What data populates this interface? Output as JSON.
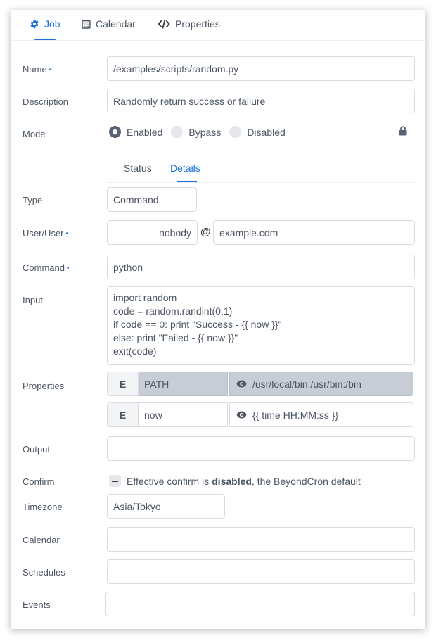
{
  "tabs": [
    {
      "label": "Job",
      "icon": "gear-icon",
      "active": true
    },
    {
      "label": "Calendar",
      "icon": "calendar-icon",
      "active": false
    },
    {
      "label": "Properties",
      "icon": "code-icon",
      "active": false
    }
  ],
  "fields": {
    "name": {
      "label": "Name",
      "required_marker": "•",
      "value": "/examples/scripts/random.py"
    },
    "description": {
      "label": "Description",
      "value": "Randomly return success or failure"
    },
    "mode": {
      "label": "Mode",
      "options": [
        "Enabled",
        "Bypass",
        "Disabled"
      ],
      "selected": "Enabled",
      "lock_icon": "lock-icon"
    },
    "subtabs": [
      {
        "label": "Status",
        "active": false
      },
      {
        "label": "Details",
        "active": true
      }
    ],
    "type": {
      "label": "Type",
      "value": "Command"
    },
    "user": {
      "label": "User/User",
      "required_marker": "•",
      "user_value": "nobody",
      "at_symbol": "@",
      "host_value": "example.com"
    },
    "command": {
      "label": "Command",
      "required_marker": "•",
      "value": "python"
    },
    "input": {
      "label": "Input",
      "value": "import random\ncode = random.randint(0,1)\nif code == 0: print \"Success - {{ now }}\"\nelse: print \"Failed - {{ now }}\"\nexit(code)"
    },
    "properties": {
      "label": "Properties",
      "rows": [
        {
          "type": "E",
          "key": "PATH",
          "value": "/usr/local/bin:/usr/bin:/bin",
          "readonly": true
        },
        {
          "type": "E",
          "key": "now",
          "value": "{{ time HH:MM:ss }}",
          "readonly": false
        }
      ]
    },
    "output": {
      "label": "Output",
      "value": ""
    },
    "confirm": {
      "label": "Confirm",
      "text_before": "Effective confirm is ",
      "text_bold": "disabled",
      "text_after": ", the BeyondCron default"
    },
    "timezone": {
      "label": "Timezone",
      "value": "Asia/Tokyo"
    },
    "calendar": {
      "label": "Calendar",
      "value": ""
    },
    "schedules": {
      "label": "Schedules",
      "value": ""
    },
    "events": {
      "label": "Events",
      "value": ""
    }
  },
  "colors": {
    "accent": "#1a6fd8",
    "readonly_bg": "#c8ccd4",
    "text": "#4b5563"
  }
}
